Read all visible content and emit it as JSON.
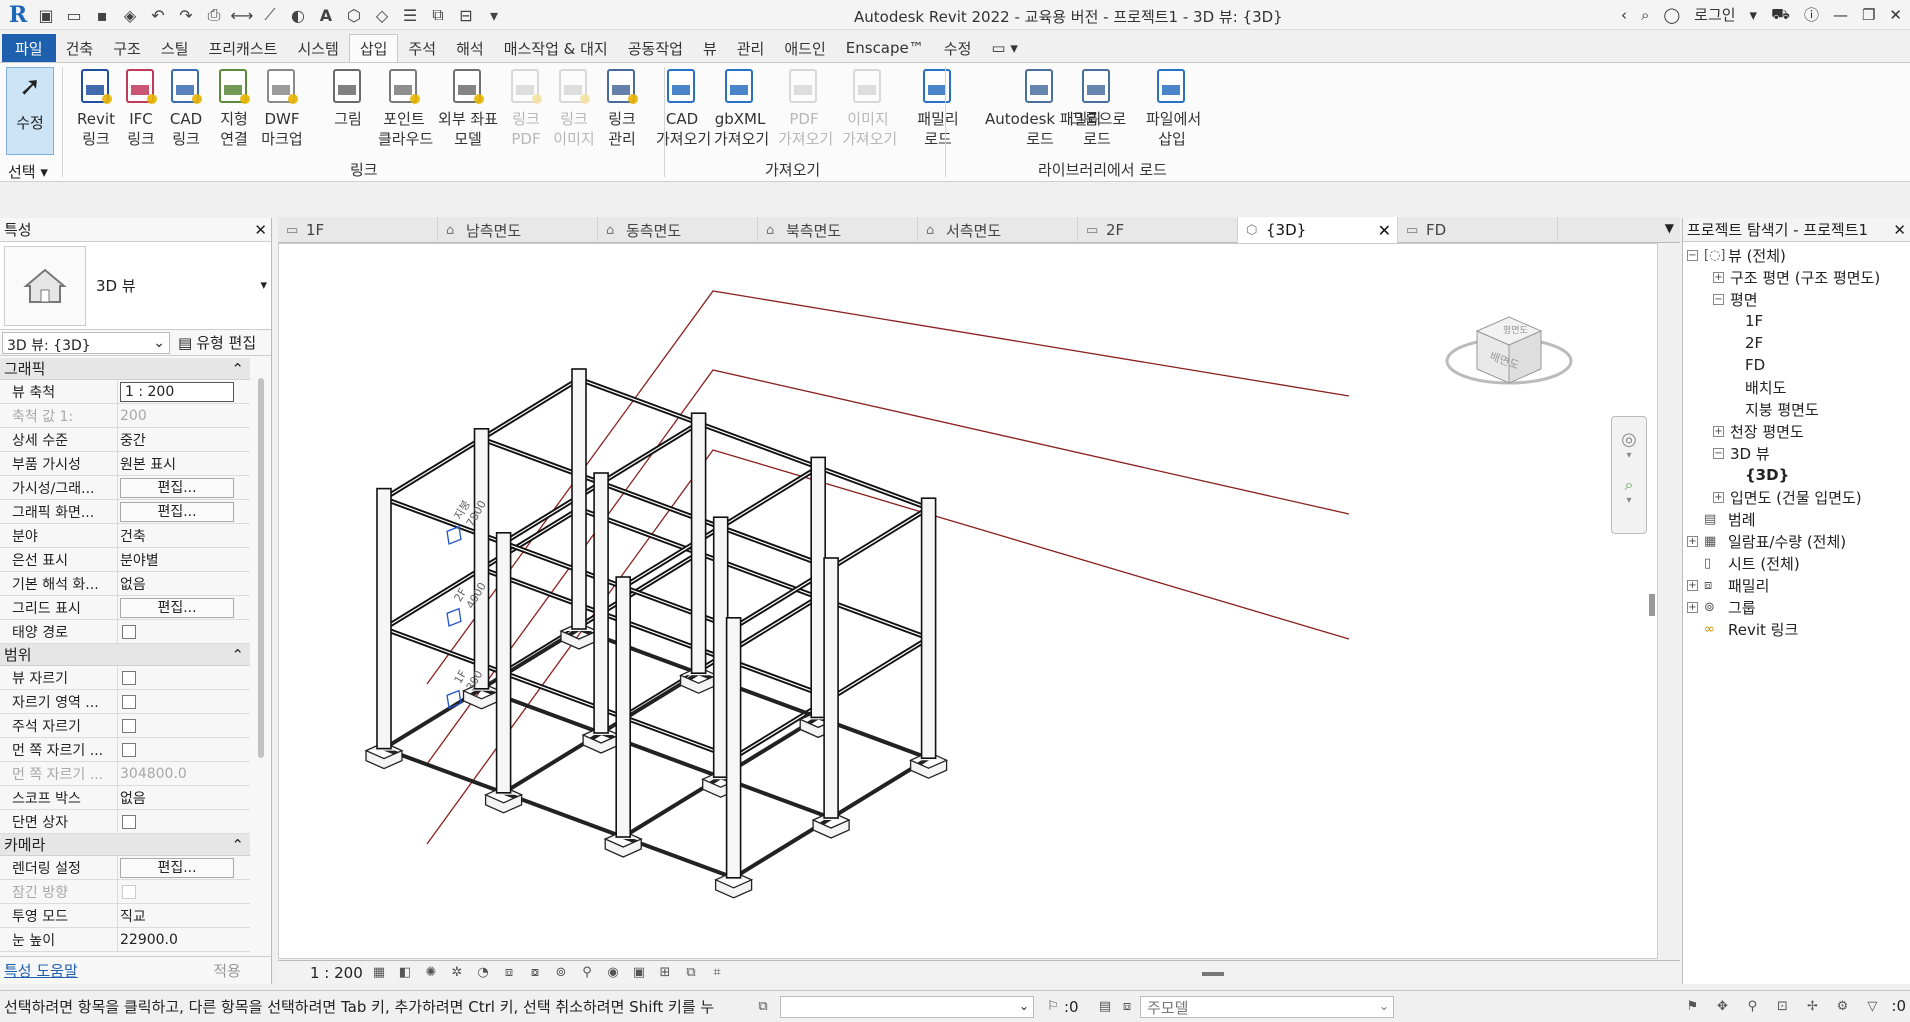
{
  "titlebar": {
    "title": "Autodesk Revit 2022 - 교육용 버전 - 프로젝트1 - 3D 뷰: {3D}",
    "user": "로그인"
  },
  "ribbon_tabs": [
    "파일",
    "건축",
    "구조",
    "스틸",
    "프리캐스트",
    "시스템",
    "삽입",
    "주석",
    "해석",
    "매스작업 & 대지",
    "공동작업",
    "뷰",
    "관리",
    "애드인",
    "Enscape™",
    "수정"
  ],
  "active_tab": "삽입",
  "ribbon": {
    "modify": "수정",
    "select": "선택",
    "buttons": [
      {
        "l1": "Revit",
        "l2": "링크",
        "icon": "revit-link-icon",
        "disabled": false
      },
      {
        "l1": "IFC",
        "l2": "링크",
        "icon": "ifc-link-icon",
        "disabled": false
      },
      {
        "l1": "CAD",
        "l2": "링크",
        "icon": "cad-link-icon",
        "disabled": false
      },
      {
        "l1": "지형",
        "l2": "연결",
        "icon": "topography-link-icon",
        "disabled": false
      },
      {
        "l1": "DWF",
        "l2": "마크업",
        "icon": "dwf-markup-icon",
        "disabled": false
      },
      {
        "l1": "그림",
        "l2": "",
        "icon": "decal-icon",
        "disabled": false
      },
      {
        "l1": "포인트",
        "l2": "클라우드",
        "icon": "point-cloud-icon",
        "disabled": false
      },
      {
        "l1": "외부 좌표",
        "l2": "모델",
        "icon": "coordination-model-icon",
        "disabled": false
      },
      {
        "l1": "링크",
        "l2": "PDF",
        "icon": "link-pdf-icon",
        "disabled": true
      },
      {
        "l1": "링크",
        "l2": "이미지",
        "icon": "link-image-icon",
        "disabled": true
      },
      {
        "l1": "링크",
        "l2": "관리",
        "icon": "manage-links-icon",
        "disabled": false
      },
      {
        "l1": "CAD",
        "l2": "가져오기",
        "icon": "import-cad-icon",
        "disabled": false
      },
      {
        "l1": "gbXML",
        "l2": "가져오기",
        "icon": "import-gbxml-icon",
        "disabled": false
      },
      {
        "l1": "PDF",
        "l2": "가져오기",
        "icon": "import-pdf-icon",
        "disabled": true
      },
      {
        "l1": "이미지",
        "l2": "가져오기",
        "icon": "import-image-icon",
        "disabled": true
      },
      {
        "l1": "패밀리",
        "l2": "로드",
        "icon": "load-family-icon",
        "disabled": false
      },
      {
        "l1": "Autodesk 패밀리",
        "l2": "로드",
        "icon": "load-autodesk-family-icon",
        "disabled": false
      },
      {
        "l1": "그룹으로",
        "l2": "로드",
        "icon": "load-as-group-icon",
        "disabled": false
      },
      {
        "l1": "파일에서",
        "l2": "삽입",
        "icon": "insert-from-file-icon",
        "disabled": false
      }
    ],
    "panels": {
      "link": "링크",
      "import": "가져오기",
      "library": "라이브러리에서 로드"
    }
  },
  "properties": {
    "title": "특성",
    "type_name": "3D 뷰",
    "selector": "3D 뷰: {3D}",
    "edit_type": "유형 편집",
    "groups": [
      {
        "name": "그래픽",
        "rows": [
          {
            "k": "뷰 축척",
            "v": "1 : 200",
            "kind": "input"
          },
          {
            "k": "축척 값    1:",
            "v": "200",
            "kind": "dim"
          },
          {
            "k": "상세 수준",
            "v": "중간",
            "kind": "text"
          },
          {
            "k": "부품 가시성",
            "v": "원본 표시",
            "kind": "text"
          },
          {
            "k": "가시성/그래...",
            "v": "편집...",
            "kind": "button"
          },
          {
            "k": "그래픽 화면...",
            "v": "편집...",
            "kind": "button"
          },
          {
            "k": "분야",
            "v": "건축",
            "kind": "text"
          },
          {
            "k": "은선 표시",
            "v": "분야별",
            "kind": "text"
          },
          {
            "k": "기본 해석 화...",
            "v": "없음",
            "kind": "text"
          },
          {
            "k": "그리드 표시",
            "v": "편집...",
            "kind": "button"
          },
          {
            "k": "태양 경로",
            "v": "",
            "kind": "check"
          }
        ]
      },
      {
        "name": "범위",
        "rows": [
          {
            "k": "뷰 자르기",
            "v": "",
            "kind": "check"
          },
          {
            "k": "자르기 영역 ...",
            "v": "",
            "kind": "check"
          },
          {
            "k": "주석 자르기",
            "v": "",
            "kind": "check"
          },
          {
            "k": "먼 쪽 자르기 ...",
            "v": "",
            "kind": "check"
          },
          {
            "k": "먼 쪽 자르기 ...",
            "v": "304800.0",
            "kind": "dim"
          },
          {
            "k": "스코프 박스",
            "v": "없음",
            "kind": "text"
          },
          {
            "k": "단면 상자",
            "v": "",
            "kind": "check"
          }
        ]
      },
      {
        "name": "카메라",
        "rows": [
          {
            "k": "렌더링 설정",
            "v": "편집...",
            "kind": "button"
          },
          {
            "k": "잠긴 방향",
            "v": "",
            "kind": "dimcheck"
          },
          {
            "k": "투영 모드",
            "v": "직교",
            "kind": "text"
          },
          {
            "k": "눈 높이",
            "v": "22900.0",
            "kind": "text"
          }
        ]
      }
    ],
    "help": "특성 도움말",
    "apply": "적용"
  },
  "view_tabs": [
    {
      "label": "1F",
      "icon": "floor-plan-icon"
    },
    {
      "label": "남측면도",
      "icon": "elevation-icon"
    },
    {
      "label": "동측면도",
      "icon": "elevation-icon"
    },
    {
      "label": "북측면도",
      "icon": "elevation-icon"
    },
    {
      "label": "서측면도",
      "icon": "elevation-icon"
    },
    {
      "label": "2F",
      "icon": "floor-plan-icon"
    },
    {
      "label": "{3D}",
      "icon": "3d-view-icon"
    },
    {
      "label": "FD",
      "icon": "floor-plan-icon"
    }
  ],
  "active_view": "{3D}",
  "canvas": {
    "levels": [
      {
        "name": "지붕",
        "elev": "7800"
      },
      {
        "name": "2F",
        "elev": "4000"
      },
      {
        "name": "1F",
        "elev": "300"
      }
    ],
    "viewcube_front": "배면도",
    "viewcube_top": "평면도"
  },
  "view_control": {
    "scale": "1 : 200"
  },
  "browser": {
    "title": "프로젝트 탐색기 - 프로젝트1",
    "nodes": [
      {
        "label": "뷰 (전체)",
        "toggle": "−",
        "icon": "views-icon",
        "level": 0,
        "sel": false
      },
      {
        "label": "구조 평면 (구조 평면도)",
        "toggle": "+",
        "icon": "",
        "level": 1,
        "sel": false
      },
      {
        "label": "평면",
        "toggle": "−",
        "icon": "",
        "level": 1,
        "sel": false
      },
      {
        "label": "1F",
        "toggle": "",
        "icon": "",
        "level": 2,
        "sel": false
      },
      {
        "label": "2F",
        "toggle": "",
        "icon": "",
        "level": 2,
        "sel": false
      },
      {
        "label": "FD",
        "toggle": "",
        "icon": "",
        "level": 2,
        "sel": false
      },
      {
        "label": "배치도",
        "toggle": "",
        "icon": "",
        "level": 2,
        "sel": false
      },
      {
        "label": "지붕 평면도",
        "toggle": "",
        "icon": "",
        "level": 2,
        "sel": false
      },
      {
        "label": "천장 평면도",
        "toggle": "+",
        "icon": "",
        "level": 1,
        "sel": false
      },
      {
        "label": "3D 뷰",
        "toggle": "−",
        "icon": "",
        "level": 1,
        "sel": false
      },
      {
        "label": "{3D}",
        "toggle": "",
        "icon": "",
        "level": 2,
        "sel": true
      },
      {
        "label": "입면도 (건물 입면도)",
        "toggle": "+",
        "icon": "",
        "level": 1,
        "sel": false
      },
      {
        "label": "범례",
        "toggle": "",
        "icon": "legends-icon",
        "level": 0,
        "sel": false
      },
      {
        "label": "일람표/수량 (전체)",
        "toggle": "+",
        "icon": "schedules-icon",
        "level": 0,
        "sel": false
      },
      {
        "label": "시트 (전체)",
        "toggle": "",
        "icon": "sheets-icon",
        "level": 0,
        "sel": false
      },
      {
        "label": "패밀리",
        "toggle": "+",
        "icon": "families-icon",
        "level": 0,
        "sel": false
      },
      {
        "label": "그룹",
        "toggle": "+",
        "icon": "groups-icon",
        "level": 0,
        "sel": false
      },
      {
        "label": "Revit 링크",
        "toggle": "",
        "icon": "revit-links-icon",
        "level": 0,
        "sel": false
      }
    ]
  },
  "statusbar": {
    "message": "선택하려면 항목을 클릭하고, 다른 항목을 선택하려면 Tab 키, 추가하려면 Ctrl 키, 선택 취소하려면 Shift 키를 누",
    "zero_a": ":0",
    "model_combo": "주모델",
    "zero_b": ":0"
  }
}
